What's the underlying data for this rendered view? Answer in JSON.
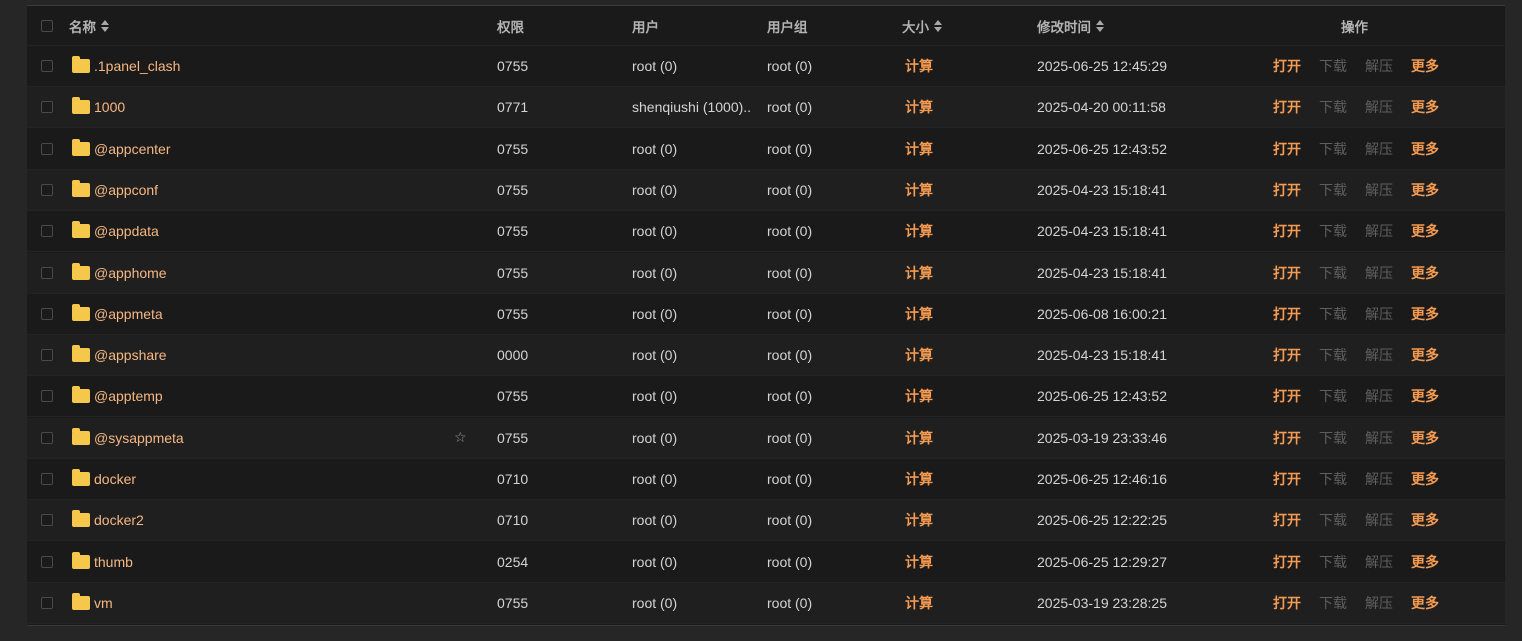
{
  "table": {
    "headers": {
      "name": "名称",
      "perm": "权限",
      "user": "用户",
      "group": "用户组",
      "size": "大小",
      "mtime": "修改时间",
      "ops": "操作"
    },
    "actions": {
      "open": "打开",
      "download": "下载",
      "extract": "解压",
      "more": "更多",
      "calc": "计算"
    },
    "rows": [
      {
        "name": ".1panel_clash",
        "perm": "0755",
        "user": "root (0)",
        "group": "root (0)",
        "mtime": "2025-06-25 12:45:29"
      },
      {
        "name": "1000",
        "perm": "0771",
        "user": "shenqiushi (1000)...",
        "group": "root (0)",
        "mtime": "2025-04-20 00:11:58"
      },
      {
        "name": "@appcenter",
        "perm": "0755",
        "user": "root (0)",
        "group": "root (0)",
        "mtime": "2025-06-25 12:43:52"
      },
      {
        "name": "@appconf",
        "perm": "0755",
        "user": "root (0)",
        "group": "root (0)",
        "mtime": "2025-04-23 15:18:41"
      },
      {
        "name": "@appdata",
        "perm": "0755",
        "user": "root (0)",
        "group": "root (0)",
        "mtime": "2025-04-23 15:18:41"
      },
      {
        "name": "@apphome",
        "perm": "0755",
        "user": "root (0)",
        "group": "root (0)",
        "mtime": "2025-04-23 15:18:41"
      },
      {
        "name": "@appmeta",
        "perm": "0755",
        "user": "root (0)",
        "group": "root (0)",
        "mtime": "2025-06-08 16:00:21"
      },
      {
        "name": "@appshare",
        "perm": "0000",
        "user": "root (0)",
        "group": "root (0)",
        "mtime": "2025-04-23 15:18:41"
      },
      {
        "name": "@apptemp",
        "perm": "0755",
        "user": "root (0)",
        "group": "root (0)",
        "mtime": "2025-06-25 12:43:52"
      },
      {
        "name": "@sysappmeta",
        "perm": "0755",
        "user": "root (0)",
        "group": "root (0)",
        "mtime": "2025-03-19 23:33:46",
        "star": "☆"
      },
      {
        "name": "docker",
        "perm": "0710",
        "user": "root (0)",
        "group": "root (0)",
        "mtime": "2025-06-25 12:46:16"
      },
      {
        "name": "docker2",
        "perm": "0710",
        "user": "root (0)",
        "group": "root (0)",
        "mtime": "2025-06-25 12:22:25"
      },
      {
        "name": "thumb",
        "perm": "0254",
        "user": "root (0)",
        "group": "root (0)",
        "mtime": "2025-06-25 12:29:27"
      },
      {
        "name": "vm",
        "perm": "0755",
        "user": "root (0)",
        "group": "root (0)",
        "mtime": "2025-03-19 23:28:25"
      }
    ]
  },
  "colors": {
    "accent": "#f49a51",
    "folder": "#f5c84c",
    "filename": "#f5b783",
    "disabled": "#5f5f5f",
    "background": "#1a1a1a"
  },
  "icons": {
    "folder": "folder-icon",
    "star": "star-icon",
    "sort": "sort-icon"
  }
}
